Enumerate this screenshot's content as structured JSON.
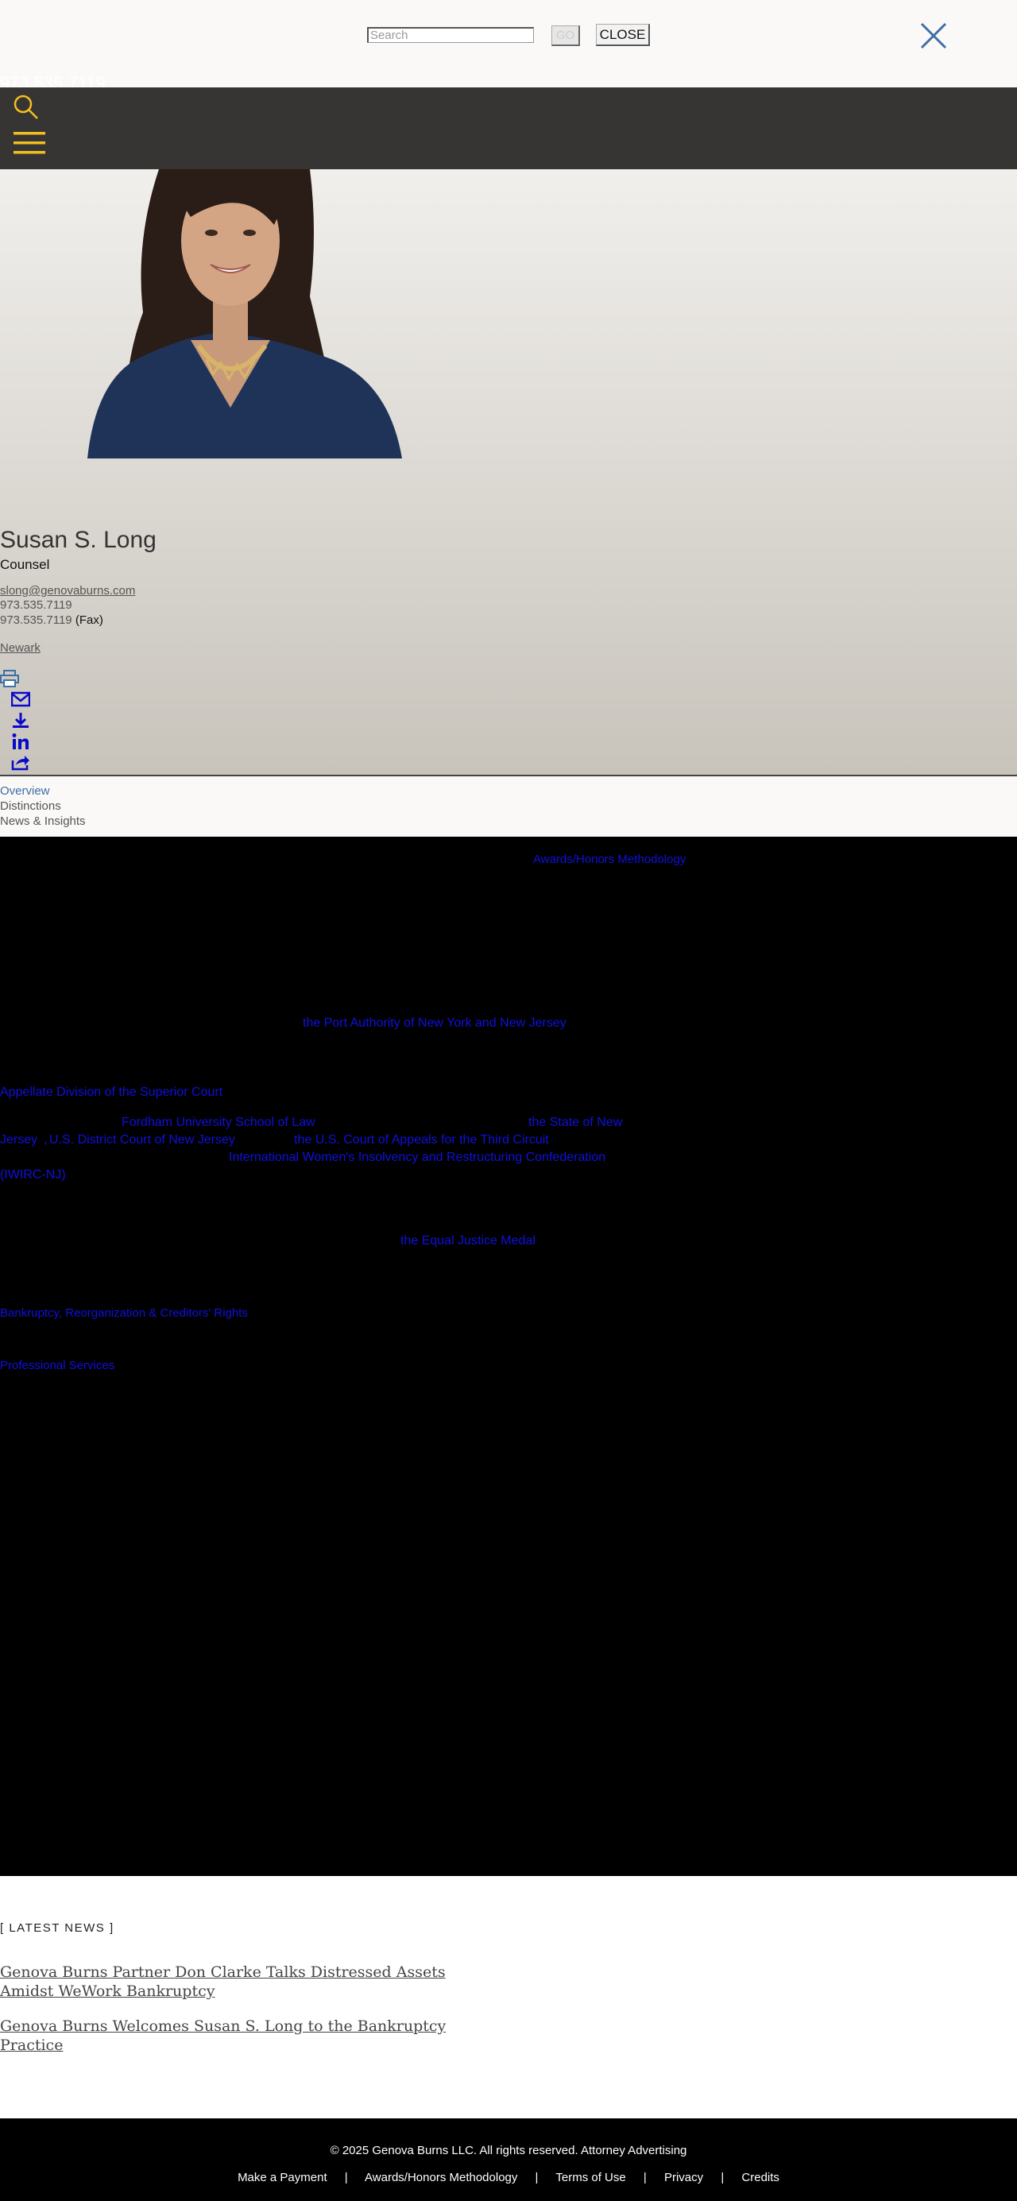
{
  "search": {
    "placeholder": "Search",
    "go_label": "GO",
    "close_label": "CLOSE"
  },
  "header": {
    "partial_text": "973.535.7119"
  },
  "profile": {
    "name": "Susan S. Long",
    "title": "Counsel",
    "email": "slong@genovaburns.com",
    "phone": "973.535.7119",
    "fax_number": "973.535.7119",
    "fax_label": "(Fax)",
    "office": "Newark"
  },
  "tabs": [
    {
      "label": "Overview"
    },
    {
      "label": "Distinctions"
    },
    {
      "label": "News & Insights"
    }
  ],
  "content_links": {
    "awards_methodology": "Awards/Honors Methodology",
    "port_authority": "the Port Authority of New York and New Jersey",
    "appellate_division": "Appellate Division of the Superior Court",
    "fordham": "Fordham University School of Law",
    "state_nj_1": "the State of New",
    "state_nj_2": "Jersey",
    "district_court": "U.S. District Court of New Jersey",
    "third_circuit": "the U.S. Court of Appeals for the Third Circuit",
    "iwirc_1": "International Women's Insolvency and Restructuring Confederation",
    "iwirc_2": "(IWIRC-NJ)",
    "equal_justice": "the Equal Justice Medal",
    "practice_bankruptcy": "Bankruptcy, Reorganization & Creditors' Rights",
    "industry_professional": "Professional Services"
  },
  "news": {
    "heading": "[ LATEST NEWS ]",
    "items": [
      {
        "title": "Genova Burns Partner Don Clarke Talks Distressed Assets Amidst WeWork Bankruptcy"
      },
      {
        "title": "Genova Burns Welcomes Susan S. Long to the Bankruptcy Practice"
      }
    ]
  },
  "footer": {
    "copyright": "© 2025 Genova Burns LLC. All rights reserved. Attorney Advertising",
    "links": [
      "Make a Payment",
      "Awards/Honors Methodology",
      "Terms of Use",
      "Privacy",
      "Credits"
    ],
    "separator": "|"
  },
  "colors": {
    "header_bg": "#373534",
    "accent_gold": "#f2c01e",
    "link_blue": "#3d6ea6",
    "content_link": "#1010dd"
  },
  "icons": [
    "close-x-icon",
    "search-icon",
    "hamburger-icon",
    "print-icon",
    "email-icon",
    "download-icon",
    "linkedin-icon",
    "share-icon"
  ]
}
